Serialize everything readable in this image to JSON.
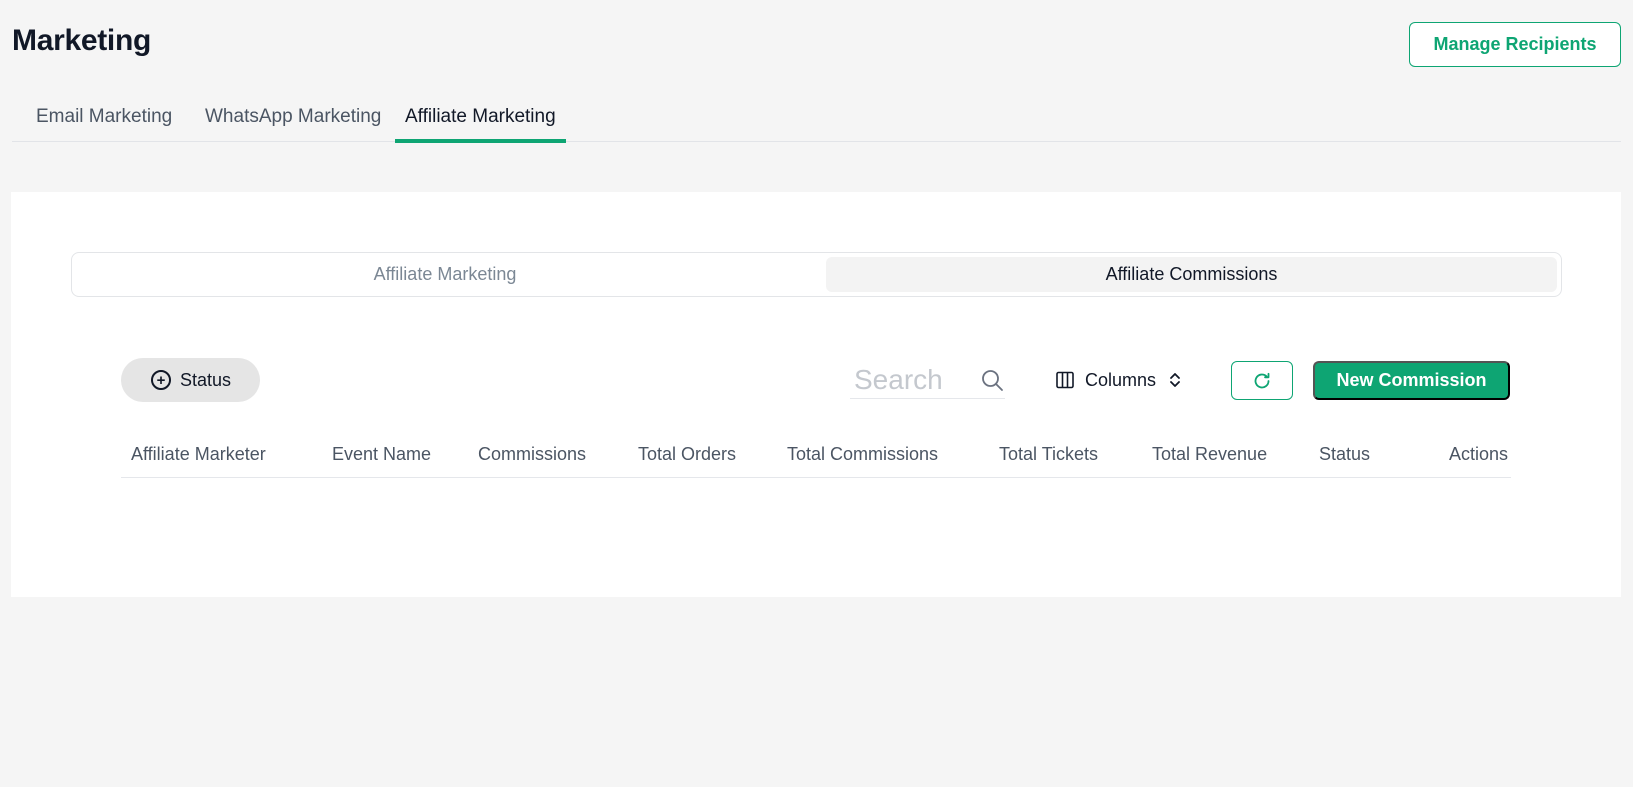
{
  "header": {
    "title": "Marketing",
    "manage_recipients_label": "Manage Recipients"
  },
  "tabs": [
    {
      "label": "Email Marketing",
      "active": false
    },
    {
      "label": "WhatsApp Marketing",
      "active": false
    },
    {
      "label": "Affiliate Marketing",
      "active": true
    }
  ],
  "segmented": {
    "left_label": "Affiliate Marketing",
    "right_label": "Affiliate Commissions",
    "selected": "Affiliate Commissions"
  },
  "toolbar": {
    "status_filter_label": "Status",
    "search_placeholder": "Search",
    "search_value": "",
    "columns_label": "Columns",
    "new_commission_label": "New Commission"
  },
  "table": {
    "columns": [
      "Affiliate Marketer",
      "Event Name",
      "Commissions",
      "Total Orders",
      "Total Commissions",
      "Total Tickets",
      "Total Revenue",
      "Status",
      "Actions"
    ],
    "rows": []
  },
  "colors": {
    "accent": "#0ea573",
    "background": "#f5f5f5",
    "card": "#ffffff"
  },
  "icons": {
    "status_filter": "plus-circle-icon",
    "search": "search-icon",
    "columns": "columns-icon",
    "sort": "chevron-up-down-icon",
    "refresh": "refresh-icon"
  }
}
